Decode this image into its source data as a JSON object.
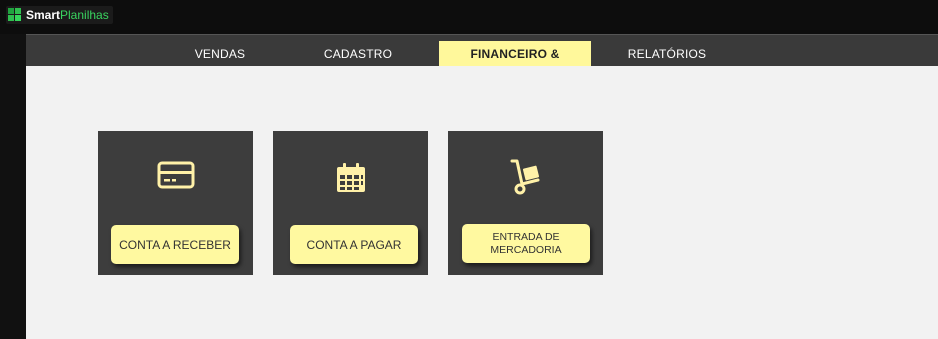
{
  "app": {
    "logo_bold": "Smart",
    "logo_light": "Planilhas"
  },
  "nav": {
    "tabs": [
      {
        "label": "VENDAS",
        "active": false
      },
      {
        "label": "CADASTRO",
        "active": false
      },
      {
        "label": "FINANCEIRO & ENTRADA",
        "active": true
      },
      {
        "label": "RELATÓRIOS",
        "active": false
      }
    ]
  },
  "cards": [
    {
      "icon": "credit-card-icon",
      "button_label": "CONTA A RECEBER"
    },
    {
      "icon": "calendar-icon",
      "button_label": "CONTA A PAGAR"
    },
    {
      "icon": "hand-truck-icon",
      "button_label_line1": "ENTRADA DE",
      "button_label_line2": "MERCADORIA"
    }
  ],
  "colors": {
    "accent": "#fff89b",
    "nav_bg": "#3a3a3a",
    "card_bg": "#3d3d3d",
    "content_bg": "#f2f2f2",
    "logo_green": "#2fbf4f"
  }
}
